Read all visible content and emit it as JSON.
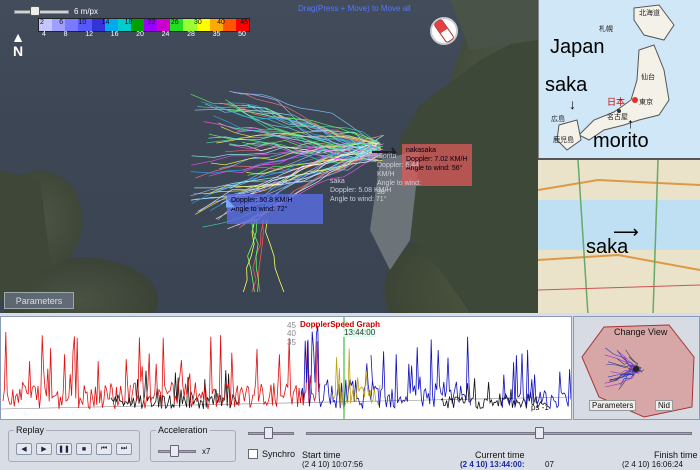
{
  "map": {
    "scale_label": "6 m/px",
    "north_label": "N",
    "drag_hint": "Drag(Press + Move) to Move all",
    "parameters_label": "Parameters",
    "speed_legend": {
      "top_ticks": [
        "2",
        "6",
        "10",
        "14",
        "18",
        "22",
        "26",
        "30",
        "40",
        "45"
      ],
      "bottom_ticks": [
        "4",
        "8",
        "12",
        "16",
        "20",
        "24",
        "28",
        "35",
        "50"
      ],
      "colors": [
        "#c6c6ff",
        "#9f9fff",
        "#7a7aff",
        "#5858ff",
        "#3434d6",
        "#00aaee",
        "#00cccc",
        "#00a000",
        "#9b00ff",
        "#cc00cc",
        "#22dd22",
        "#99ff33",
        "#ffff00",
        "#ffaa00",
        "#ff5500",
        "#ff0000"
      ]
    },
    "info_red": [
      "nakasaka",
      "Doppler: 7.02 KM/H",
      "Angle to wind: 56°"
    ],
    "info_plain_1": [
      "morito",
      "Doppler: 6.44 KM/H",
      "Angle to wind: 98°"
    ],
    "info_plain_2": [
      "saka",
      "Doppler: 5.08 KM/H",
      "Angle to wind: 71°"
    ],
    "info_blue": [
      "Doppler: 50.8 KM/H",
      "Angle to wind: 72°"
    ]
  },
  "inset": {
    "label_japan": "Japan",
    "label_saka": "saka",
    "label_morito": "morito",
    "label_saka_bottom": "saka",
    "jp_city_labels": [
      "北海道",
      "札幌",
      "仙台",
      "東京",
      "日本",
      "名古屋",
      "広島",
      "鹿児島"
    ]
  },
  "graph": {
    "title": "DopplerSpeed Graph",
    "current_marker": "13:44:00",
    "left_tick": "45",
    "tick_2": "40",
    "tick_3": "35",
    "ps_label": "ps -1"
  },
  "mini": {
    "change_view": "Change View",
    "parameters_label": "Parameters",
    "nid_label": "Nid"
  },
  "controls": {
    "replay_title": "Replay",
    "acceleration_title": "Acceleration",
    "acceleration_value": "x7",
    "synchro_label": "Synchro",
    "start_label": "Start time",
    "start_value": "(2 4 10) 10:07:56",
    "current_label": "Current time",
    "current_value": "(2 4 10) 13:44:00:",
    "current_ms": "07",
    "finish_label": "Finish time",
    "finish_value": "(2 4 10) 16:06:24"
  }
}
